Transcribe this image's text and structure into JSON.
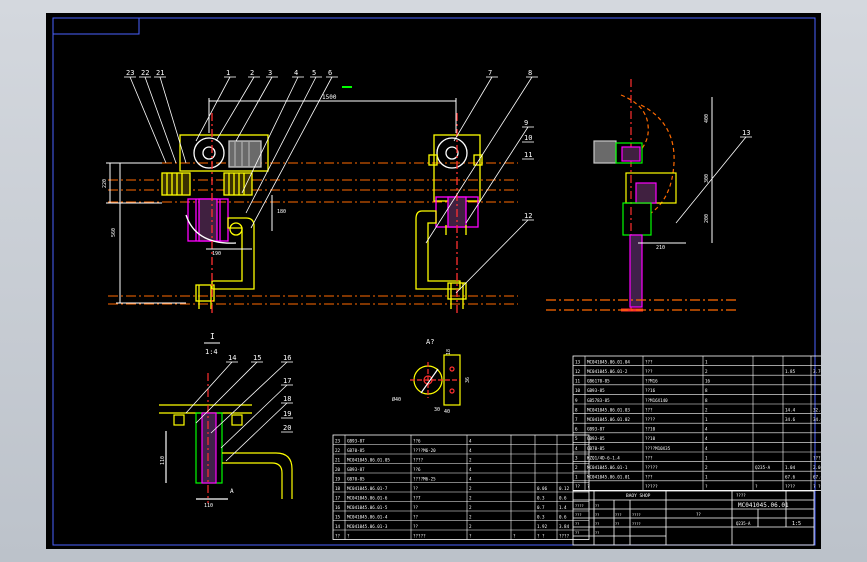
{
  "drawing": {
    "colors": {
      "background": "#000000",
      "frame": "#ffffff",
      "body": "#ffff00",
      "rail": "#ff6a00",
      "center": "#ff3030",
      "hatch": "#ff00ff",
      "motor": "#c8c8c8",
      "green": "#00ff00",
      "dim": "#00ffff"
    },
    "dimensions": {
      "span": "1500",
      "rail_h": "220",
      "post": "560",
      "d1": "190",
      "d2": "180",
      "side_top": "400",
      "side_mid": "300",
      "side_bot": "200",
      "side_w": "210",
      "det_h": "110",
      "det_w": "110",
      "a_w": "40",
      "a_h1": "36",
      "a_h2": "18",
      "a_d": "Ø40",
      "a_r": "30"
    },
    "balloons": [
      "1",
      "2",
      "3",
      "4",
      "5",
      "6",
      "7",
      "8",
      "9",
      "10",
      "11",
      "12",
      "13",
      "14",
      "15",
      "16",
      "17",
      "18",
      "19",
      "20",
      "21",
      "22",
      "23"
    ],
    "views": {
      "detail_label": "I",
      "detail_scale": "1:4",
      "detail_scale_num": "1",
      "section_label": "A?",
      "arrow_letter": "A"
    }
  },
  "parts_right": {
    "rows": [
      [
        "13",
        "MC041045.06.01.04",
        "???",
        "1",
        "",
        "",
        ""
      ],
      [
        "12",
        "MC041045.06.01-2",
        "???",
        "2",
        "",
        "1.85",
        "3.70"
      ],
      [
        "11",
        "GB6170-85",
        "??M16",
        "16",
        "",
        "",
        ""
      ],
      [
        "10",
        "GB93-85",
        "??16",
        "8",
        "",
        "",
        ""
      ],
      [
        "9",
        "GB5783-85",
        "??M16X140",
        "8",
        "",
        "",
        ""
      ],
      [
        "8",
        "MC041045.06.01.03",
        "???",
        "2",
        "",
        "14.4",
        "32.8"
      ],
      [
        "7",
        "MC041045.06.01.02",
        "????",
        "1",
        "",
        "34.6",
        "34.6"
      ],
      [
        "6",
        "GB93-87",
        "??10",
        "4",
        "",
        "",
        ""
      ],
      [
        "5",
        "GB93-85",
        "??10",
        "4",
        "",
        "",
        ""
      ],
      [
        "4",
        "GB70-85",
        "????M10X35",
        "4",
        "",
        "",
        ""
      ],
      [
        "3",
        "KZQ1/4D-6-1.4",
        "???",
        "1",
        "",
        "",
        "???"
      ],
      [
        "2",
        "MC041045.06.01-1",
        "?????",
        "2",
        "Q235-A",
        "1.04",
        "2.08"
      ],
      [
        "1",
        "MC041045.06.01.01",
        "???",
        "1",
        "",
        "67.6",
        "67.6"
      ],
      [
        "??",
        "?",
        "?????",
        "?",
        "?",
        "????",
        "? ?"
      ]
    ]
  },
  "parts_left": {
    "rows": [
      [
        "23",
        "GB93-87",
        "??6",
        "4",
        "",
        "",
        ""
      ],
      [
        "22",
        "GB70-85",
        "????M6-20",
        "4",
        "",
        "",
        ""
      ],
      [
        "21",
        "MC041045.06.01.05",
        "????",
        "2",
        "",
        "",
        ""
      ],
      [
        "20",
        "GB93-87",
        "??6",
        "4",
        "",
        "",
        ""
      ],
      [
        "19",
        "GB70-85",
        "????M6-25",
        "4",
        "",
        "",
        ""
      ],
      [
        "18",
        "MC041045.06.01-7",
        "??",
        "2",
        "",
        "0.06",
        "0.12"
      ],
      [
        "17",
        "MC041045.06.01-6",
        "??7",
        "2",
        "",
        "0.3",
        "0.6"
      ],
      [
        "16",
        "MC041045.06.01-5",
        "??",
        "2",
        "",
        "0.7",
        "1.4"
      ],
      [
        "15",
        "MC041045.06.01-4",
        "??",
        "2",
        "",
        "0.3",
        "0.6"
      ],
      [
        "14",
        "MC041045.06.01-3",
        "??",
        "2",
        "",
        "1.92",
        "3.84"
      ],
      [
        "??",
        "?",
        "?????",
        "?",
        "?",
        "? ?",
        "????"
      ]
    ]
  },
  "title_block": {
    "drawing_no": "MC041045.06.01",
    "company": "BAOY SHOP",
    "mark_a": "????",
    "mark_b": "??",
    "scale": "1:5",
    "material_label": "Q235-A",
    "small_labels": [
      "????",
      "??",
      "???",
      "??",
      "???",
      "????",
      "??",
      "??",
      "??",
      "????",
      "??",
      "??"
    ]
  }
}
